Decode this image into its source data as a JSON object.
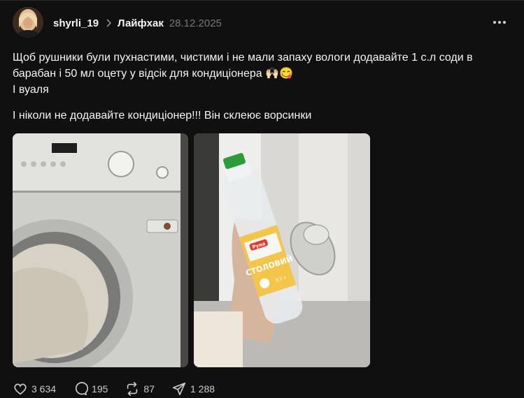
{
  "post": {
    "username": "shyrli_19",
    "topic": "Лайфхак",
    "date": "28.12.2025",
    "paragraphs": [
      "Щоб рушники були пухнастими, чистими і не мали запаху вологи додавайте 1 с.л соди в барабан і 50 мл оцету у відсік для кондиціонера 🙌🏻😋",
      "І вуаля",
      "І ніколи не додавайте кондиціонер!!! Він склеює ворсинки"
    ]
  },
  "images": [
    {
      "icon": "washing-machine-photo"
    },
    {
      "icon": "vinegar-bottle-photo",
      "label_brand": "Руна",
      "label_main": "СТОЛОВИЙ",
      "label_small": "0,5 л"
    }
  ],
  "actions": {
    "likes": "3 634",
    "comments": "195",
    "reposts": "87",
    "shares": "1 288"
  },
  "colors": {
    "background": "#101010",
    "text": "#f3f5f7",
    "muted": "#777777"
  }
}
